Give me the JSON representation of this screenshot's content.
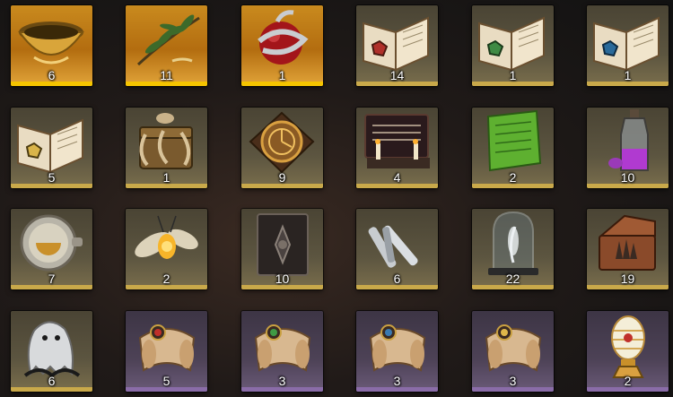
{
  "inventory": {
    "items": [
      {
        "name": "golden-bowl-icon",
        "rarity": "gold",
        "count": "6"
      },
      {
        "name": "herb-sprig-icon",
        "rarity": "gold",
        "count": "11"
      },
      {
        "name": "apple-serpent-icon",
        "rarity": "gold",
        "count": "1"
      },
      {
        "name": "red-rune-book-icon",
        "rarity": "khaki",
        "count": "14"
      },
      {
        "name": "green-rune-book-icon",
        "rarity": "khaki",
        "count": "1"
      },
      {
        "name": "blue-rune-book-icon",
        "rarity": "khaki",
        "count": "1"
      },
      {
        "name": "yellow-rune-book-icon",
        "rarity": "khaki",
        "count": "5"
      },
      {
        "name": "tentacle-chest-icon",
        "rarity": "khaki",
        "count": "1"
      },
      {
        "name": "clockwork-dial-icon",
        "rarity": "khaki",
        "count": "9"
      },
      {
        "name": "ouija-board-icon",
        "rarity": "khaki",
        "count": "4"
      },
      {
        "name": "green-tablet-icon",
        "rarity": "khaki",
        "count": "2"
      },
      {
        "name": "purple-potion-icon",
        "rarity": "khaki",
        "count": "10"
      },
      {
        "name": "brass-pocket-watch-icon",
        "rarity": "khaki",
        "count": "7"
      },
      {
        "name": "firefly-icon",
        "rarity": "khaki",
        "count": "2"
      },
      {
        "name": "dark-grimoire-icon",
        "rarity": "khaki",
        "count": "10"
      },
      {
        "name": "silver-bullets-icon",
        "rarity": "khaki",
        "count": "6"
      },
      {
        "name": "bell-jar-feather-icon",
        "rarity": "khaki",
        "count": "22"
      },
      {
        "name": "glove-box-icon",
        "rarity": "khaki",
        "count": "19"
      },
      {
        "name": "ghost-cloth-icon",
        "rarity": "khaki",
        "count": "6"
      },
      {
        "name": "red-seal-scroll-icon",
        "rarity": "purple",
        "count": "5"
      },
      {
        "name": "green-seal-scroll-icon",
        "rarity": "purple",
        "count": "3"
      },
      {
        "name": "blue-seal-scroll-icon",
        "rarity": "purple",
        "count": "3"
      },
      {
        "name": "gold-seal-scroll-icon",
        "rarity": "purple",
        "count": "3"
      },
      {
        "name": "jeweled-egg-icon",
        "rarity": "purple",
        "count": "2"
      }
    ]
  }
}
